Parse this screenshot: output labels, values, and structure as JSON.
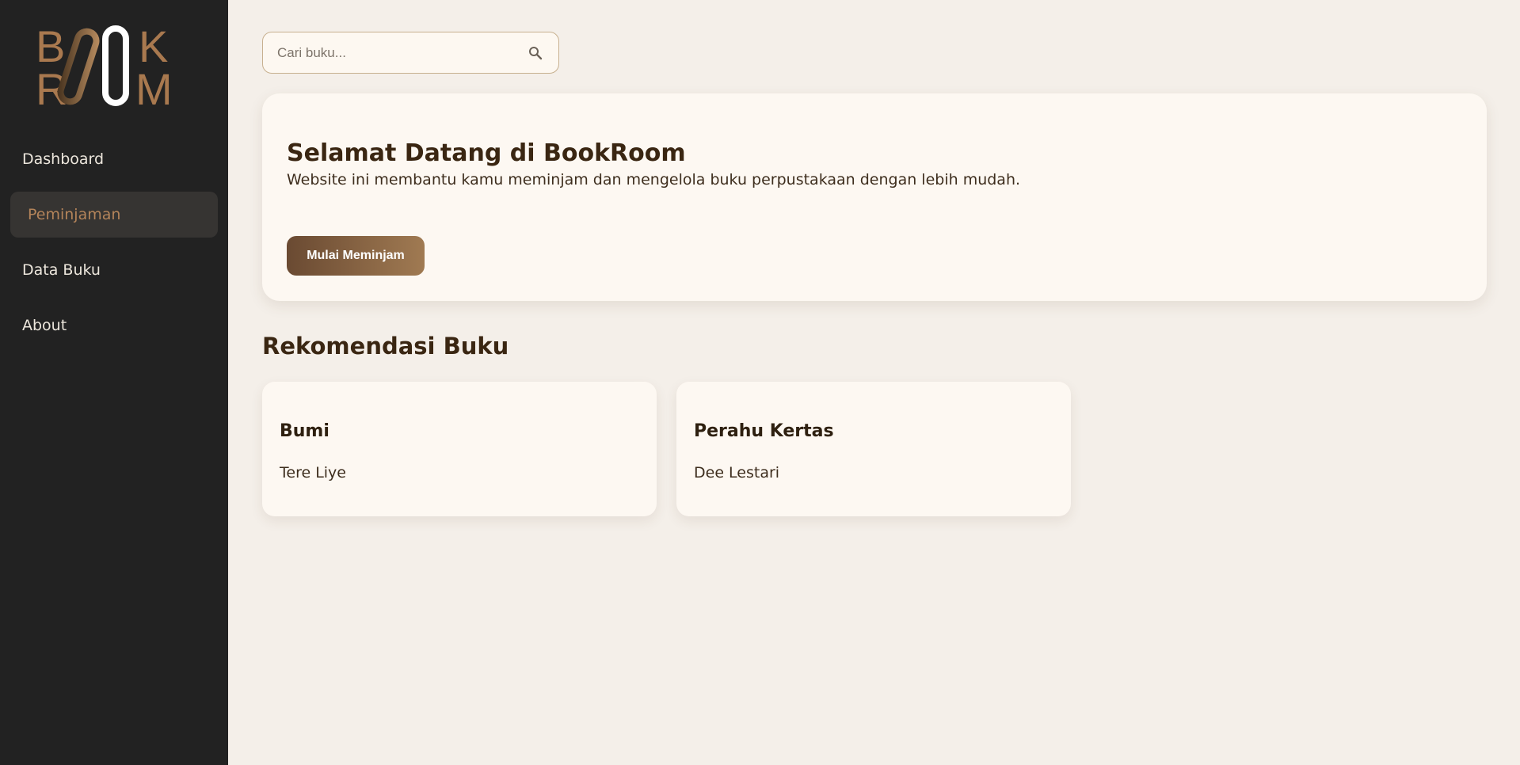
{
  "brand": {
    "logo_text": "BOOKROOM",
    "colors": {
      "logo_brown": "#a9794f",
      "logo_white": "#ffffff",
      "accent": "#b4845a"
    }
  },
  "sidebar": {
    "items": [
      {
        "label": "Dashboard",
        "active": false
      },
      {
        "label": "Peminjaman",
        "active": true
      },
      {
        "label": "Data Buku",
        "active": false
      },
      {
        "label": "About",
        "active": false
      }
    ]
  },
  "search": {
    "placeholder": "Cari buku...",
    "value": "",
    "icon": "search-icon"
  },
  "hero": {
    "title": "Selamat Datang di BookRoom",
    "description": "Website ini membantu kamu meminjam dan mengelola buku perpustakaan dengan lebih mudah.",
    "button_label": "Mulai Meminjam"
  },
  "recommendations": {
    "title": "Rekomendasi Buku",
    "books": [
      {
        "title": "Bumi",
        "author": "Tere Liye"
      },
      {
        "title": "Perahu Kertas",
        "author": "Dee Lestari"
      }
    ]
  }
}
